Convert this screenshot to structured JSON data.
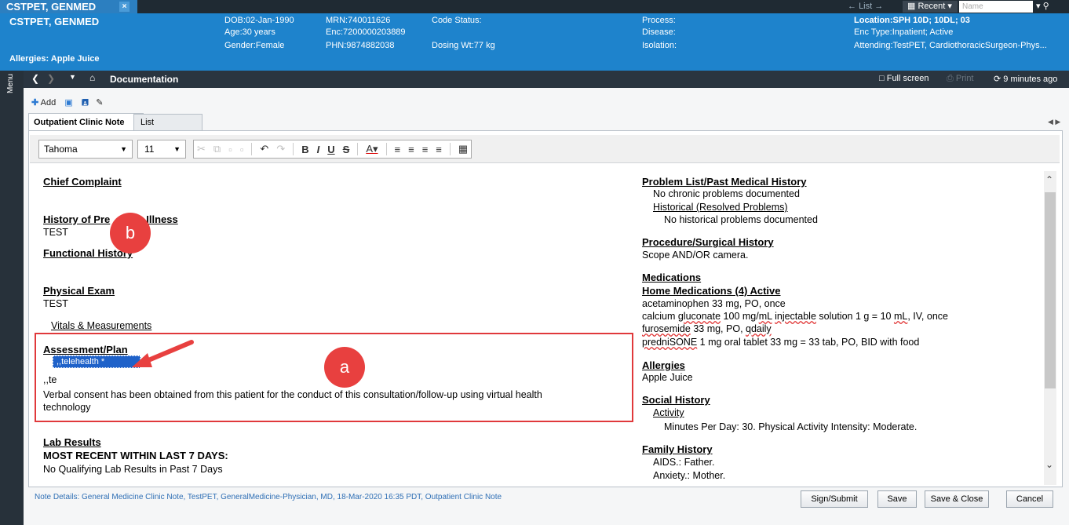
{
  "patient_tab": {
    "name": "CSTPET, GENMED",
    "close": "×"
  },
  "top_nav": {
    "list": "List",
    "recent": "Recent",
    "name_placeholder": "Name"
  },
  "banner": {
    "name": "CSTPET, GENMED",
    "allergies": "Allergies: Apple Juice",
    "dob": "DOB:02-Jan-1990",
    "age": "Age:30 years",
    "gender": "Gender:Female",
    "mrn": "MRN:740011626",
    "enc": "Enc:7200000203889",
    "phn": "PHN:9874882038",
    "code_status": "Code Status:",
    "dosing_wt": "Dosing Wt:77 kg",
    "process": "Process:",
    "disease": "Disease:",
    "isolation": "Isolation:",
    "location": "Location:SPH 10D; 10DL; 03",
    "enc_type": "Enc Type:Inpatient;  Active",
    "attending": "Attending:TestPET, CardiothoracicSurgeon-Phys..."
  },
  "menu_label": "Menu",
  "docbar": {
    "title": "Documentation",
    "fullscreen": "Full screen",
    "print": "Print",
    "refreshed": "9 minutes ago"
  },
  "toolbar": {
    "add": "Add"
  },
  "tabs": {
    "note": "Outpatient Clinic Note",
    "note_close": "×",
    "list": "List"
  },
  "format": {
    "font": "Tahoma",
    "size": "11"
  },
  "left_col": {
    "chief_complaint": "Chief Complaint",
    "hpi": "History of Present Illness",
    "hpi_visible": "History of Pre",
    "hpi_tail": "Illness",
    "hpi_text": "TEST",
    "functional_history": "Functional History",
    "physical_exam": "Physical Exam",
    "physical_exam_text": "TEST",
    "vitals": "Vitals & Measurements",
    "assessment_plan": "Assessment/Plan",
    "autotext_popup": ",,telehealth *",
    "typed": ",,te",
    "consent_line1": "Verbal consent has been obtained from this patient for the conduct of this consultation/follow-up using virtual health",
    "consent_line2": "technology",
    "lab_results": "Lab Results",
    "most_recent": "MOST RECENT WITHIN LAST 7 DAYS:",
    "no_lab": "No Qualifying Lab Results in Past 7 Days"
  },
  "right_col": {
    "problem_list": "Problem List/Past Medical History",
    "no_chronic": "No chronic problems documented",
    "historical": "Historical (Resolved Problems)",
    "no_historical": "No historical problems documented",
    "procedure": "Procedure/Surgical History",
    "procedure_text": "Scope AND/OR camera.",
    "medications": "Medications",
    "home_meds": "Home Medications (4) Active",
    "med1": "acetaminophen 33 mg, PO, once",
    "med2a": "calcium ",
    "med2b": "gluconate",
    "med2c": " 100 mg/",
    "med2d": "mL",
    "med2e": " ",
    "med2f": "injectable",
    "med2g": " solution 1 g = 10 ",
    "med2h": "mL",
    "med2i": ", IV, once",
    "med3a": "furosemide",
    "med3b": " 33 mg, PO, ",
    "med3c": "qdaily",
    "med4a": "predniSONE",
    "med4b": " 1 mg oral tablet 33 mg = 33 tab, PO, BID with food",
    "allergies": "Allergies",
    "allergies_text": "Apple Juice",
    "social": "Social History",
    "activity": "Activity",
    "activity_text": "Minutes Per Day: 30. Physical Activity Intensity: Moderate.",
    "family": "Family History",
    "family1": "AIDS.: Father.",
    "family2": "Anxiety.: Mother."
  },
  "annotations": {
    "a": "a",
    "b": "b"
  },
  "footer": {
    "details": "Note Details: General Medicine Clinic Note, TestPET, GeneralMedicine-Physician, MD, 18-Mar-2020 16:35 PDT, Outpatient Clinic Note",
    "sign": "Sign/Submit",
    "save": "Save",
    "save_close": "Save & Close",
    "cancel": "Cancel"
  },
  "colors": {
    "banner": "#1e83cc",
    "annotation": "#e0393b",
    "autotext": "#1f62c9"
  }
}
